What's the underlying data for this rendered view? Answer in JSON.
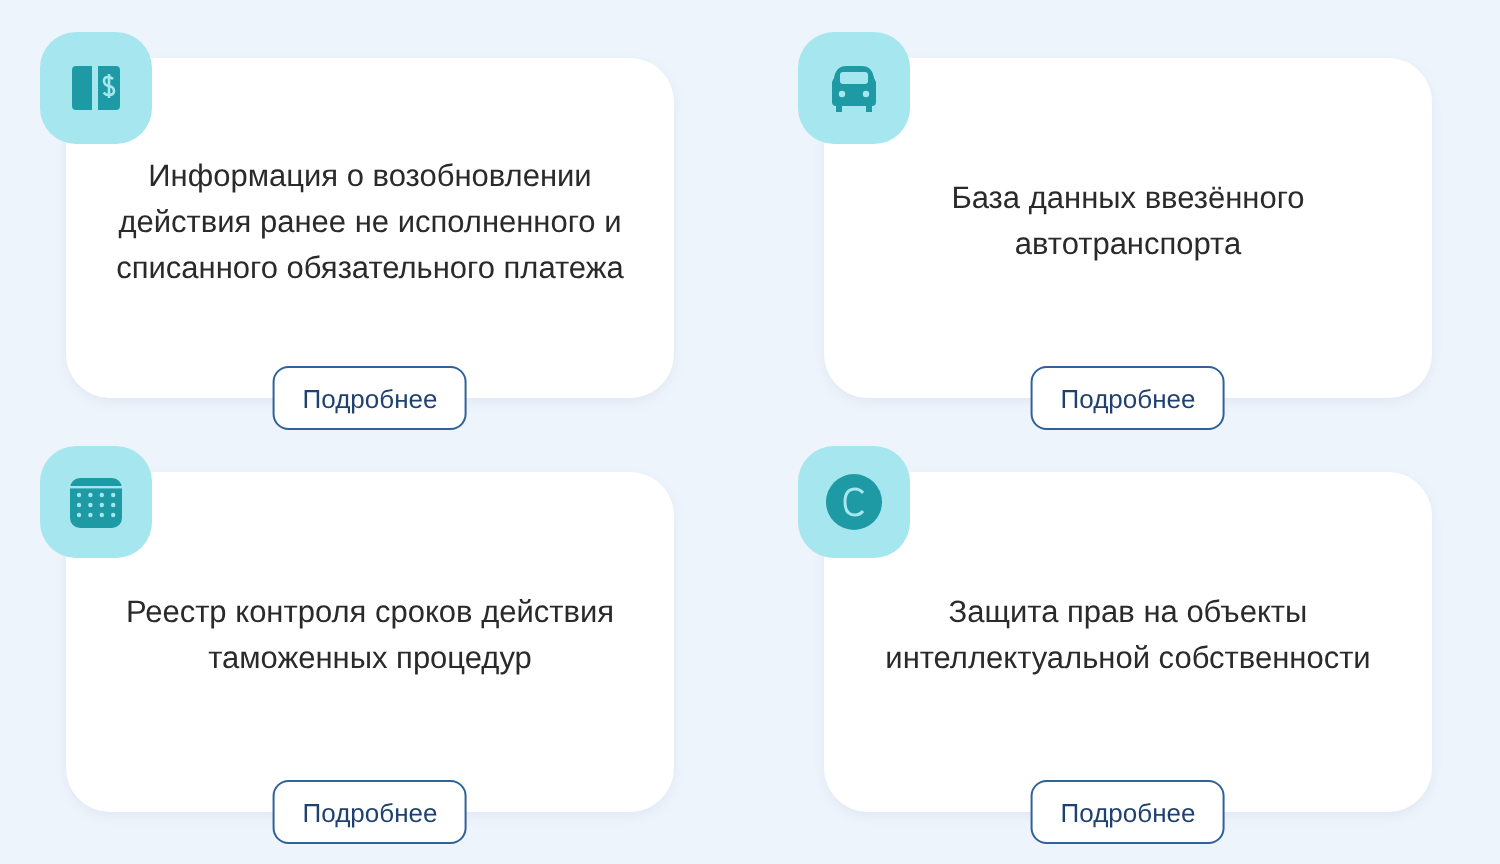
{
  "cards": [
    {
      "kind": "book",
      "title": "Информация о возобновлении\nдействия ранее не исполненного и\nсписанного обязательного платежа",
      "button": "Подробнее"
    },
    {
      "kind": "car",
      "title": "База данных ввезённого\nавтотранспорта",
      "button": "Подробнее"
    },
    {
      "kind": "calendar",
      "title": "Реестр контроля сроков действия\nтаможенных процедур",
      "button": "Подробнее"
    },
    {
      "kind": "copyright",
      "title": "Защита прав на объекты\nинтеллектуальной собственности",
      "button": "Подробнее"
    }
  ]
}
